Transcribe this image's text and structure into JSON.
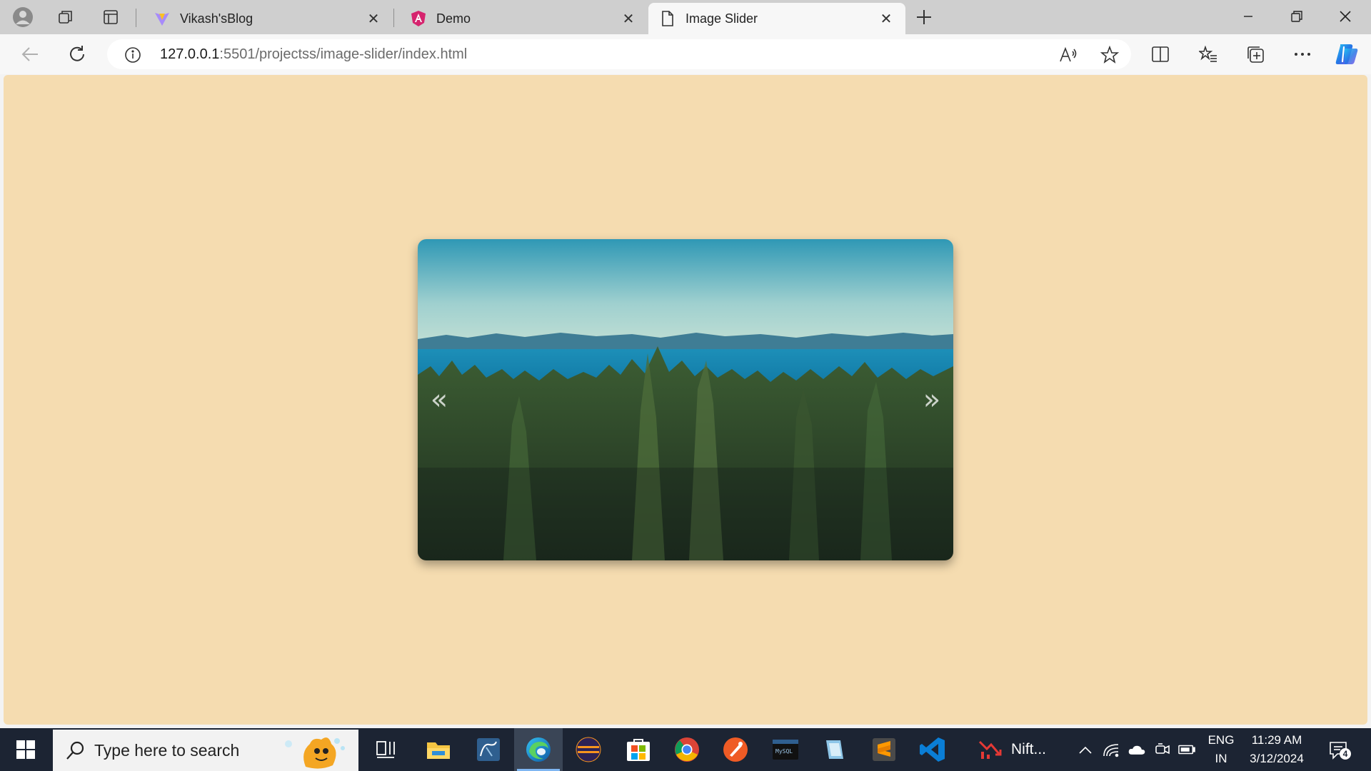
{
  "browser": {
    "tabs": [
      {
        "title": "Vikash'sBlog",
        "icon": "vite-icon"
      },
      {
        "title": "Demo",
        "icon": "angular-icon"
      },
      {
        "title": "Image Slider",
        "icon": "page-icon",
        "active": true
      }
    ],
    "url": {
      "host": "127.0.0.1",
      "rest": ":5501/projectss/image-slider/index.html"
    }
  },
  "page": {
    "background_color": "#f5dcb0",
    "slider": {
      "prev_label": "«",
      "next_label": "»"
    }
  },
  "taskbar": {
    "search_placeholder": "Type here to search",
    "app_label": "Nift...",
    "language": "ENG",
    "region": "IN",
    "time": "11:29 AM",
    "date": "3/12/2024",
    "notification_count": "4"
  }
}
